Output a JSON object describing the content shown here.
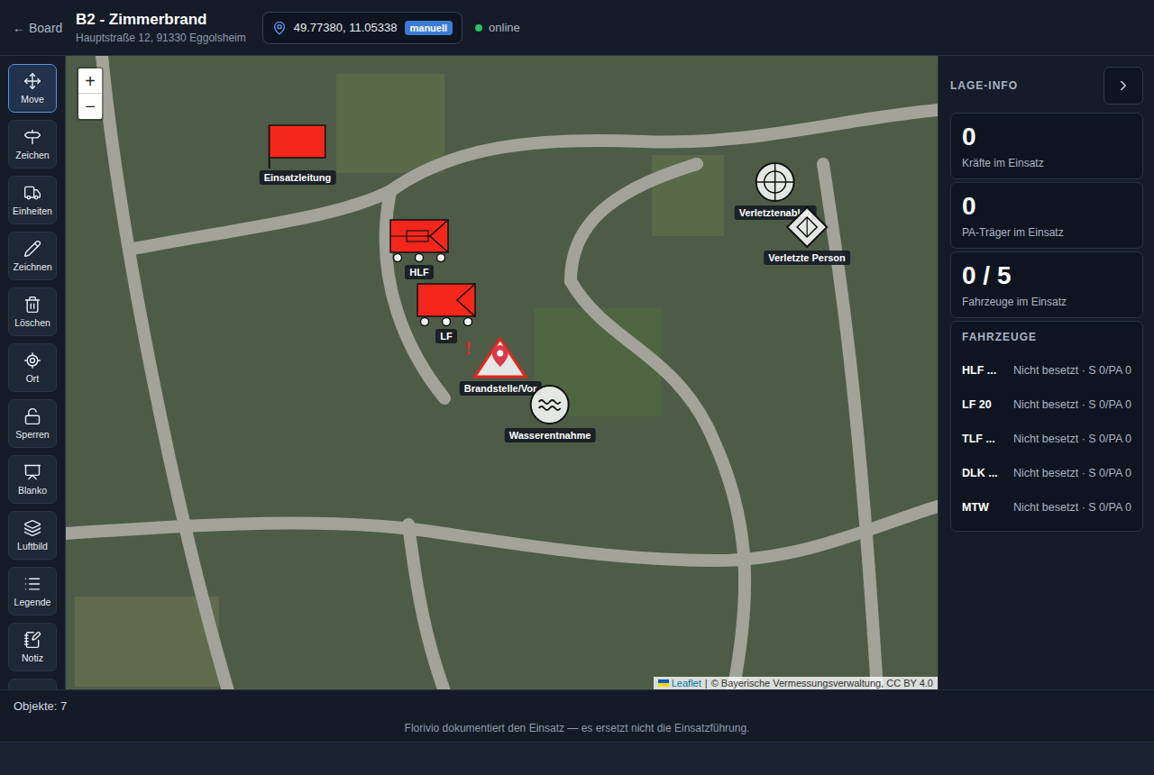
{
  "header": {
    "back": "←",
    "back_label": "Board",
    "title": "B2 - Zimmerbrand",
    "address": "Hauptstraße 12, 91330 Eggolsheim",
    "coords": "49.77380, 11.05338",
    "coord_mode": "manuell",
    "status": "online",
    "online": true
  },
  "toolbar": [
    {
      "label": "Move",
      "selected": true
    },
    {
      "label": "Zeichen",
      "selected": false
    },
    {
      "label": "Einheiten",
      "selected": false
    },
    {
      "label": "Zeichnen",
      "selected": false
    },
    {
      "label": "Löschen",
      "selected": false
    },
    {
      "label": "Ort",
      "selected": false
    },
    {
      "label": "Sperren",
      "selected": false
    },
    {
      "label": "Blanko",
      "selected": false
    },
    {
      "label": "Luftbild",
      "selected": false
    },
    {
      "label": "Legende",
      "selected": false
    },
    {
      "label": "Notiz",
      "selected": false
    },
    {
      "label": "",
      "selected": false
    }
  ],
  "map": {
    "zoom_in": "+",
    "zoom_out": "−",
    "markers": [
      {
        "kind": "flag",
        "label": "Einsatzleitung"
      },
      {
        "kind": "hlf",
        "label": "HLF"
      },
      {
        "kind": "vehicle",
        "label": "LF"
      },
      {
        "kind": "fire",
        "label": "Brandstelle/Vor",
        "badge": "!"
      },
      {
        "kind": "water",
        "label": "Wasserentnahme"
      },
      {
        "kind": "collection",
        "label": "Verletztenablag"
      },
      {
        "kind": "casualty",
        "label": "Verletzte Person"
      }
    ],
    "attribution": {
      "brand": "Leaflet",
      "separator": "|",
      "credit": "© Bayerische Vermessungsverwaltung, CC BY 4.0"
    }
  },
  "panel": {
    "title": "LAGE-INFO",
    "stats": [
      {
        "value": "0",
        "label": "Kräfte im Einsatz"
      },
      {
        "value": "0",
        "label": "PA-Träger im Einsatz"
      },
      {
        "value": "0 / 5",
        "label": "Fahrzeuge im Einsatz"
      }
    ],
    "vehicles_title": "FAHRZEUGE",
    "vehicles": [
      {
        "name": "HLF ...",
        "status": "Nicht besetzt · S 0/PA 0"
      },
      {
        "name": "LF 20",
        "status": "Nicht besetzt · S 0/PA 0"
      },
      {
        "name": "TLF ...",
        "status": "Nicht besetzt · S 0/PA 0"
      },
      {
        "name": "DLK ...",
        "status": "Nicht besetzt · S 0/PA 0"
      },
      {
        "name": "MTW",
        "status": "Nicht besetzt · S 0/PA 0"
      }
    ]
  },
  "footer": {
    "objects": "Objekte: 7",
    "disclaimer": "Florivio dokumentiert den Einsatz — es ersetzt nicht die Einsatzführung."
  }
}
